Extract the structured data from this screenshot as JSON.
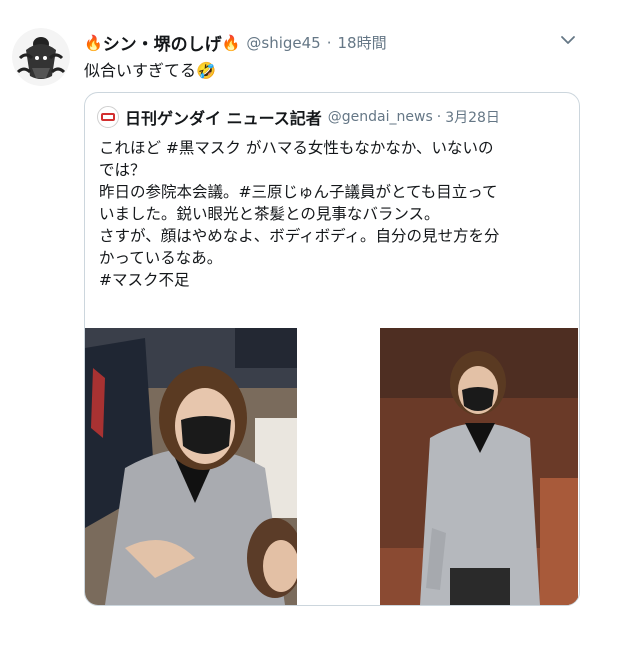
{
  "tweet": {
    "display_name": "シン・堺のしげ",
    "fire_left": "🔥",
    "fire_right": "🔥",
    "handle": "@shige45",
    "separator": "·",
    "time": "18時間",
    "text": "似合いすぎてる🤣",
    "caret_icon": "chevron-down-icon"
  },
  "quoted": {
    "display_name": "日刊ゲンダイ ニュース記者",
    "handle": "@gendai_news",
    "separator": "·",
    "time": "3月28日",
    "lines": [
      "これほど #黒マスク がハマる女性もなかなか、いないの",
      "では？",
      "昨日の参院本会議。#三原じゅん子議員がとても目立って",
      "いました。鋭い眼光と茶髪との見事なバランス。",
      "さすが、顔はやめなよ、ボディボディ。自分の見せ方を分",
      "かっているなあ。",
      "#マスク不足"
    ]
  },
  "colors": {
    "text": "#14171a",
    "secondary": "#657786",
    "border": "#ccd6dd"
  }
}
